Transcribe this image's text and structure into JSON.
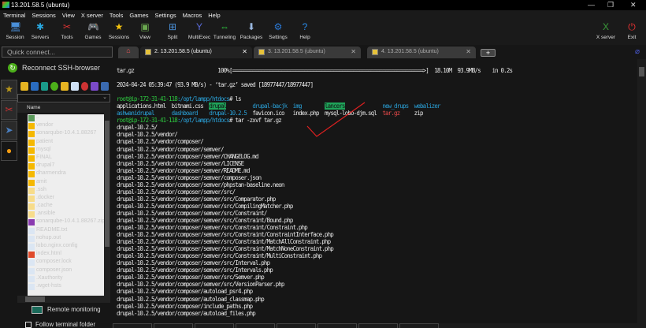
{
  "window": {
    "title": "13.201.58.5 (ubuntu)",
    "minimize": "—",
    "restore": "❐",
    "close": "✕"
  },
  "menu": [
    "Terminal",
    "Sessions",
    "View",
    "X server",
    "Tools",
    "Games",
    "Settings",
    "Macros",
    "Help"
  ],
  "toolbar": [
    {
      "label": "Session",
      "icon": "monitor-icon",
      "glyph": "🖥"
    },
    {
      "label": "Servers",
      "icon": "servers-icon",
      "glyph": "✱"
    },
    {
      "label": "Tools",
      "icon": "tools-icon",
      "glyph": "✂"
    },
    {
      "label": "Games",
      "icon": "gamepad-icon",
      "glyph": "🎮"
    },
    {
      "label": "Sessions",
      "icon": "star-icon",
      "glyph": "★"
    },
    {
      "label": "View",
      "icon": "view-icon",
      "glyph": "▣"
    },
    {
      "label": "Split",
      "icon": "split-icon",
      "glyph": "⊞"
    },
    {
      "label": "MultiExec",
      "icon": "multiexec-icon",
      "glyph": "Y"
    },
    {
      "label": "Tunneling",
      "icon": "tunnel-icon",
      "glyph": "⇔"
    },
    {
      "label": "Packages",
      "icon": "package-icon",
      "glyph": "⬇"
    },
    {
      "label": "Settings",
      "icon": "gear-icon",
      "glyph": "⚙"
    },
    {
      "label": "Help",
      "icon": "help-icon",
      "glyph": "?"
    }
  ],
  "toolbar_right": [
    {
      "label": "X server",
      "icon": "xserver-icon",
      "glyph": "X"
    },
    {
      "label": "Exit",
      "icon": "power-icon",
      "glyph": "⏻"
    }
  ],
  "quick_connect": {
    "placeholder": "Quick connect..."
  },
  "tabs": [
    {
      "label": "2. 13.201.58.5 (ubuntu)",
      "active": true
    },
    {
      "label": "3. 13.201.58.5 (ubuntu)"
    },
    {
      "label": "4. 13.201.58.5 (ubuntu)"
    }
  ],
  "tab_close": "✕",
  "new_tab": "+",
  "sidebar": {
    "reconnect": "Reconnect SSH-browser",
    "column_name": "Name",
    "files": [
      {
        "name": "..",
        "type": "up"
      },
      {
        "name": "vendor",
        "type": "folder"
      },
      {
        "name": "sonarqube-10.4.1.88267",
        "type": "folder"
      },
      {
        "name": "patient",
        "type": "folder"
      },
      {
        "name": "mysql",
        "type": "folder"
      },
      {
        "name": "FINAL",
        "type": "folder"
      },
      {
        "name": "drupal7",
        "type": "folder"
      },
      {
        "name": "dharmendra",
        "type": "folder"
      },
      {
        "name": "amit",
        "type": "folder"
      },
      {
        "name": ".ssh",
        "type": "hidden"
      },
      {
        "name": ".docker",
        "type": "hidden"
      },
      {
        "name": ".cache",
        "type": "hidden"
      },
      {
        "name": ".ansible",
        "type": "hidden"
      },
      {
        "name": "sonarqube-10.4.1.88267.zip",
        "type": "zip"
      },
      {
        "name": "README.txt",
        "type": "file"
      },
      {
        "name": "nohup.out",
        "type": "file"
      },
      {
        "name": "lobo.nginx.config",
        "type": "file"
      },
      {
        "name": "index.html",
        "type": "html"
      },
      {
        "name": "composer.lock",
        "type": "file"
      },
      {
        "name": "composer.json",
        "type": "file"
      },
      {
        "name": ".Xauthority",
        "type": "file"
      },
      {
        "name": ".wget-hsts",
        "type": "file"
      }
    ],
    "remote_monitoring": "Remote monitoring",
    "follow_folder": "Follow terminal folder"
  },
  "terminal": {
    "progress_line": "tar.gz                             100%[==================================================================>]  18.10M  93.9MB/s    in 0.2s",
    "saved_line": "2024-04-24 05:39:47 (93.9 MB/s) - ‘tar.gz’ saved [18977447/18977447]",
    "prompt_user": "root@ip-172-31-41-118",
    "prompt_path": ":/opt/lampp/htdocs",
    "prompt_end": "# ",
    "cmd1": "ls",
    "ls_rows": [
      [
        {
          "n": "applications.html"
        },
        {
          "n": "bitnami.css"
        },
        {
          "n": "drupal",
          "c": "hl"
        },
        {
          "n": "drupal-bacjk",
          "c": "b"
        },
        {
          "n": "img",
          "c": "b"
        },
        {
          "n": "lancers",
          "c": "hl"
        },
        {
          "n": "new_drups",
          "c": "b"
        },
        {
          "n": "webalizer",
          "c": "b"
        }
      ],
      [
        {
          "n": "ashwanidrupal",
          "c": "b"
        },
        {
          "n": "dashboard",
          "c": "b"
        },
        {
          "n": "drupal-10.2.5",
          "c": "b"
        },
        {
          "n": "favicon.ico"
        },
        {
          "n": "index.php"
        },
        {
          "n": "mysql-lobo-djm.sql"
        },
        {
          "n": "tar.gz",
          "c": "r"
        },
        {
          "n": "zip"
        }
      ]
    ],
    "cmd2": "tar -zxvf tar.gz",
    "output": [
      "drupal-10.2.5/",
      "drupal-10.2.5/vendor/",
      "drupal-10.2.5/vendor/composer/",
      "drupal-10.2.5/vendor/composer/semver/",
      "drupal-10.2.5/vendor/composer/semver/CHANGELOG.md",
      "drupal-10.2.5/vendor/composer/semver/LICENSE",
      "drupal-10.2.5/vendor/composer/semver/README.md",
      "drupal-10.2.5/vendor/composer/semver/composer.json",
      "drupal-10.2.5/vendor/composer/semver/phpstan-baseline.neon",
      "drupal-10.2.5/vendor/composer/semver/src/",
      "drupal-10.2.5/vendor/composer/semver/src/Comparator.php",
      "drupal-10.2.5/vendor/composer/semver/src/CompilingMatcher.php",
      "drupal-10.2.5/vendor/composer/semver/src/Constraint/",
      "drupal-10.2.5/vendor/composer/semver/src/Constraint/Bound.php",
      "drupal-10.2.5/vendor/composer/semver/src/Constraint/Constraint.php",
      "drupal-10.2.5/vendor/composer/semver/src/Constraint/ConstraintInterface.php",
      "drupal-10.2.5/vendor/composer/semver/src/Constraint/MatchAllConstraint.php",
      "drupal-10.2.5/vendor/composer/semver/src/Constraint/MatchNoneConstraint.php",
      "drupal-10.2.5/vendor/composer/semver/src/Constraint/MultiConstraint.php",
      "drupal-10.2.5/vendor/composer/semver/src/Interval.php",
      "drupal-10.2.5/vendor/composer/semver/src/Intervals.php",
      "drupal-10.2.5/vendor/composer/semver/src/Semver.php",
      "drupal-10.2.5/vendor/composer/semver/src/VersionParser.php",
      "drupal-10.2.5/vendor/composer/autoload_psr4.php",
      "drupal-10.2.5/vendor/composer/autoload_classmap.php",
      "drupal-10.2.5/vendor/composer/include_paths.php",
      "drupal-10.2.5/vendor/composer/autoload_files.php"
    ]
  },
  "colors": {
    "prompt": "#2ecc40",
    "dir": "#2aa1d8",
    "archive": "#e84a4a",
    "highlight": "#1fa35a",
    "annotation": "#e02020"
  }
}
